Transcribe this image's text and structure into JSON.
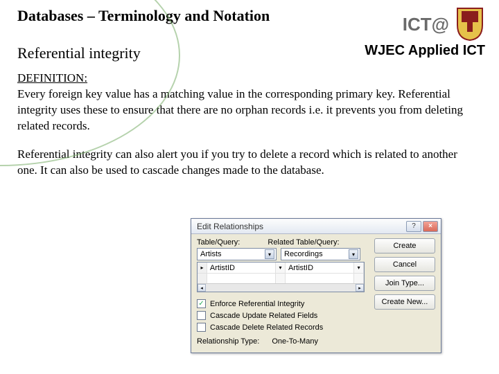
{
  "header": {
    "title": "Databases – Terminology and Notation",
    "subheading": "Referential integrity",
    "brand_top": "ICT@",
    "brand_sub": "WJEC Applied ICT"
  },
  "body": {
    "def_label": "DEFINITION:",
    "def_text": "Every foreign key value has a matching value in the corresponding primary key. Referential integrity uses these to ensure that there are no orphan records i.e. it prevents you from deleting related records.",
    "para2": "Referential integrity can also alert you if you try to delete a record which is related to another one. It can also be used to cascade changes made to the database."
  },
  "dialog": {
    "title": "Edit Relationships",
    "help_icon": "?",
    "close_icon": "×",
    "col1": "Table/Query:",
    "col2": "Related Table/Query:",
    "combo1": "Artists",
    "combo2": "Recordings",
    "field1": "ArtistID",
    "field2": "ArtistID",
    "chk1": "Enforce Referential Integrity",
    "chk2": "Cascade Update Related Fields",
    "chk3": "Cascade Delete Related Records",
    "rel_label": "Relationship Type:",
    "rel_value": "One-To-Many",
    "buttons": {
      "create": "Create",
      "cancel": "Cancel",
      "join": "Join Type...",
      "new": "Create New..."
    }
  }
}
